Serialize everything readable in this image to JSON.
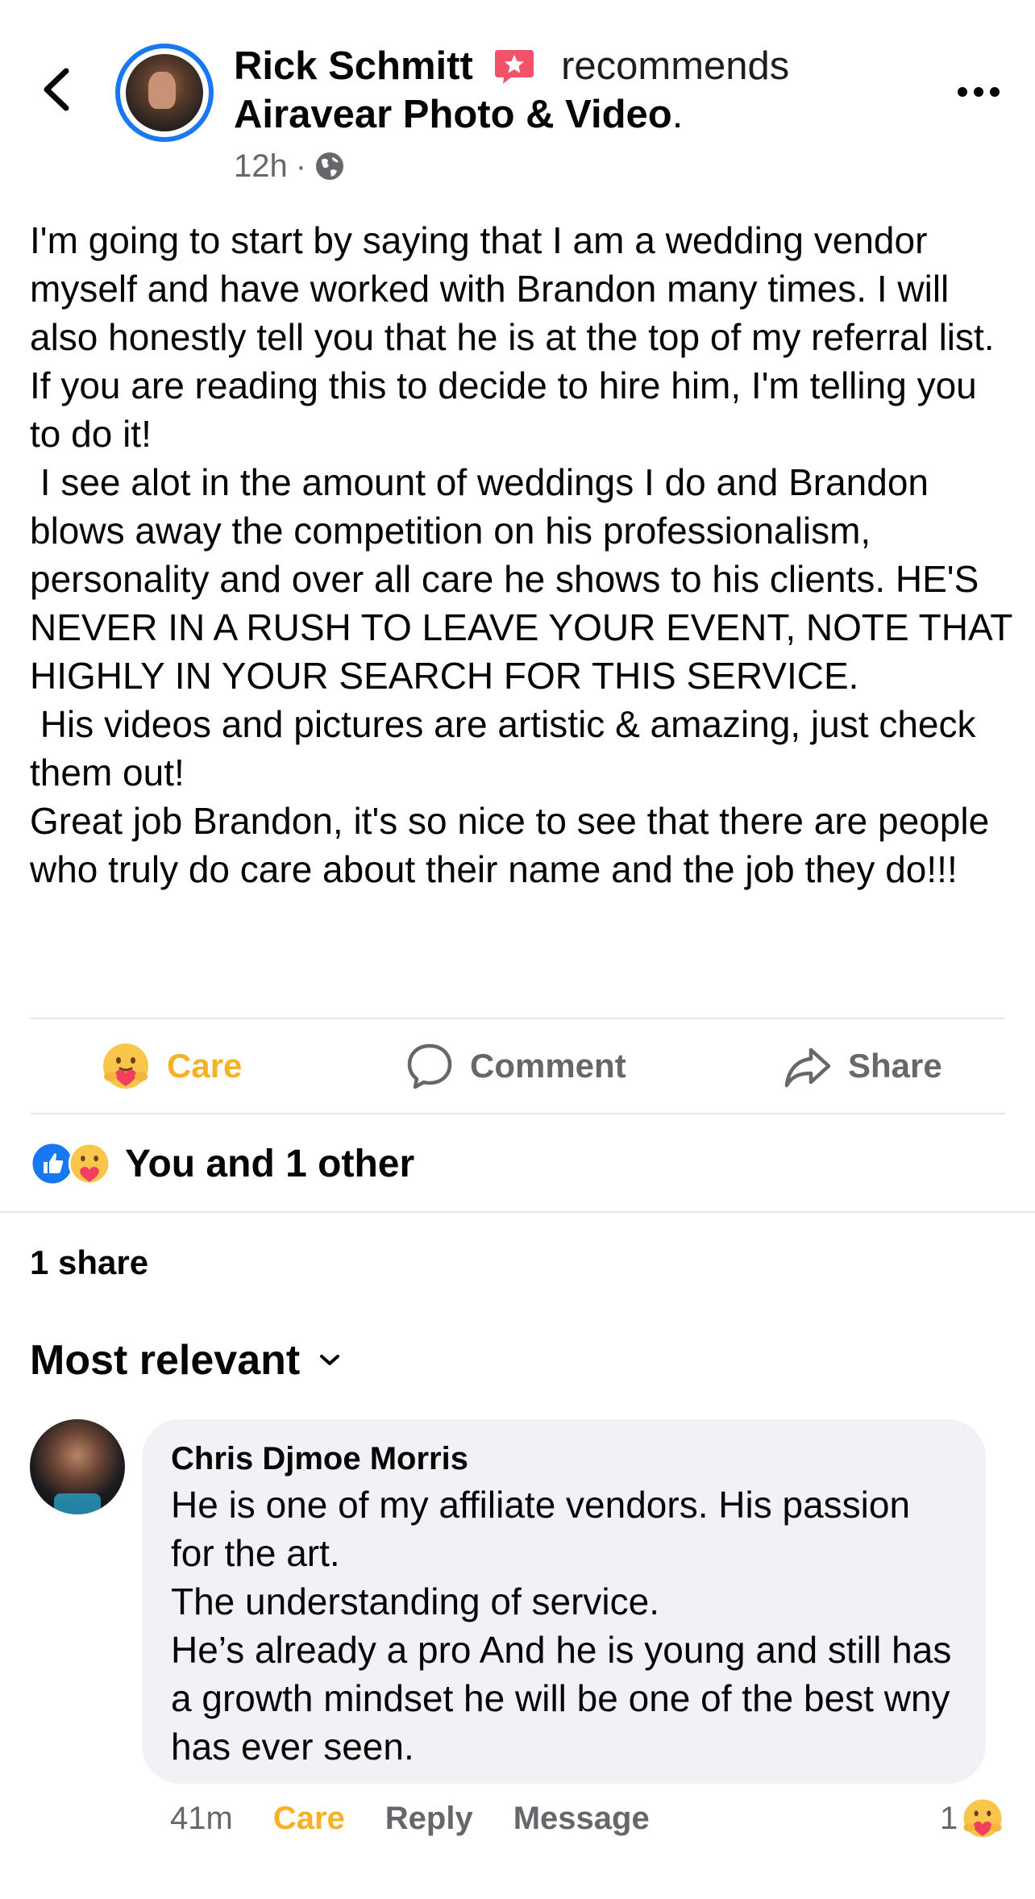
{
  "header": {
    "author": "Rick Schmitt",
    "verb": "recommends",
    "page": "Airavear Photo & Video",
    "page_suffix": ".",
    "time": "12h",
    "separator": "·"
  },
  "post": {
    "text": "I'm going to start by saying that I am a wedding vendor myself and have worked with Brandon many times. I will also honestly tell you that he is at the top of my referral list. If you are reading this to decide to hire him, I'm telling you to do it!\n I see alot in the amount of weddings I do and Brandon blows away the competition on his professionalism, personality and over all care he shows to his clients. HE'S NEVER IN A RUSH TO LEAVE YOUR EVENT, NOTE THAT HIGHLY IN YOUR SEARCH FOR THIS SERVICE.\n His videos and pictures are artistic & amazing, just check them out!\nGreat job Brandon, it's so nice to see that there are people who truly do care about their name and the job they do!!!"
  },
  "actions": {
    "care": "Care",
    "comment": "Comment",
    "share": "Share"
  },
  "reactions": {
    "summary": "You and 1 other",
    "icons": [
      "like-icon",
      "care-emoji-icon"
    ]
  },
  "shares": "1 share",
  "sort": {
    "label": "Most relevant"
  },
  "comment": {
    "name": "Chris Djmoe Morris",
    "text": "He is one of my affiliate vendors. His passion for the art.\nThe understanding of service.\nHe’s already a pro And he is young and still has a growth mindset he will be one of the best wny has ever seen.",
    "time": "41m",
    "care": "Care",
    "reply": "Reply",
    "message": "Message",
    "reaction_count": "1"
  },
  "colors": {
    "accent": "#1877f2",
    "care": "#f7b125",
    "secondary_text": "#65676b",
    "bubble": "#f0f2f5",
    "divider": "#e4e6eb"
  }
}
